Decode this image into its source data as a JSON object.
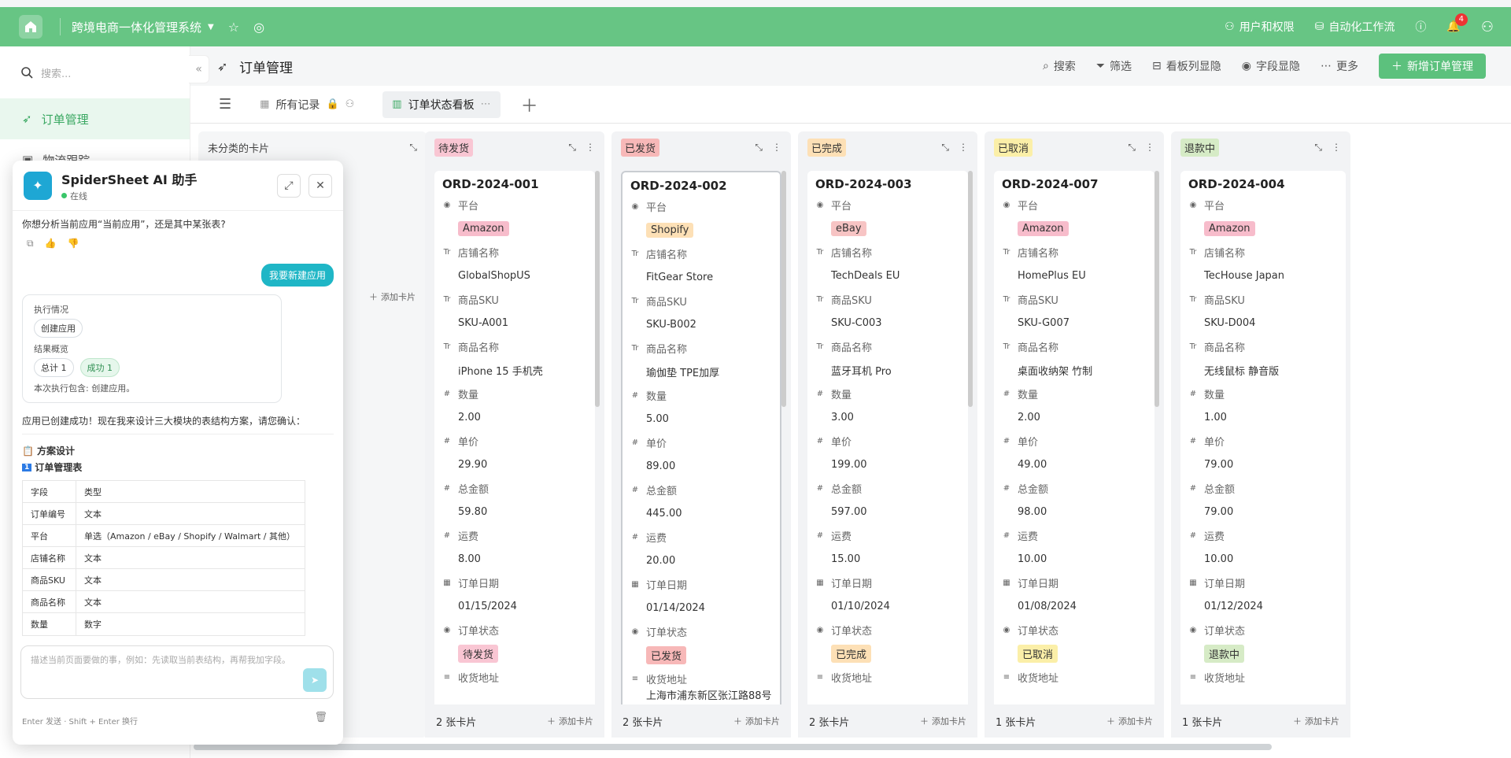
{
  "topbar": {
    "app_title": "跨境电商一体化管理系统",
    "users_label": "用户和权限",
    "workflow_label": "自动化工作流",
    "notification_count": "4"
  },
  "sidebar": {
    "search_placeholder": "搜索...",
    "items": [
      {
        "label": "订单管理"
      },
      {
        "label": "物流跟踪"
      }
    ]
  },
  "header": {
    "title": "订单管理",
    "actions": [
      "搜索",
      "筛选",
      "看板列显隐",
      "字段显隐",
      "更多"
    ],
    "primary": "新增订单管理"
  },
  "views": {
    "all": "所有记录",
    "kanban": "订单状态看板"
  },
  "board": {
    "uncategorized": {
      "title": "未分类的卡片",
      "add": "添加卡片"
    },
    "field_labels": [
      "平台",
      "店铺名称",
      "商品SKU",
      "商品名称",
      "数量",
      "单价",
      "总金额",
      "运费",
      "订单日期",
      "订单状态",
      "收货地址"
    ],
    "columns": [
      {
        "name": "待发货",
        "bg": "#f9c6d3",
        "color": "#333",
        "count": "2 张卡片",
        "add": "添加卡片",
        "card": {
          "id": "ORD-2024-001",
          "platform": "Amazon",
          "store": "GlobalShopUS",
          "sku": "SKU-A001",
          "product": "iPhone 15 手机壳",
          "qty": "2.00",
          "price": "29.90",
          "total": "59.80",
          "shipping": "8.00",
          "date": "01/15/2024",
          "status": "待发货",
          "address": ""
        }
      },
      {
        "name": "已发货",
        "bg": "#f7b8b8",
        "color": "#333",
        "count": "2 张卡片",
        "add": "添加卡片",
        "card": {
          "id": "ORD-2024-002",
          "platform": "Shopify",
          "store": "FitGear Store",
          "sku": "SKU-B002",
          "product": "瑜伽垫 TPE加厚",
          "qty": "5.00",
          "price": "89.00",
          "total": "445.00",
          "shipping": "20.00",
          "date": "01/14/2024",
          "status": "已发货",
          "address": "上海市浦东新区张江路88号"
        }
      },
      {
        "name": "已完成",
        "bg": "#fde0b6",
        "color": "#333",
        "count": "2 张卡片",
        "add": "添加卡片",
        "card": {
          "id": "ORD-2024-003",
          "platform": "eBay",
          "store": "TechDeals EU",
          "sku": "SKU-C003",
          "product": "蓝牙耳机 Pro",
          "qty": "3.00",
          "price": "199.00",
          "total": "597.00",
          "shipping": "15.00",
          "date": "01/10/2024",
          "status": "已完成",
          "address": ""
        }
      },
      {
        "name": "已取消",
        "bg": "#fbefa8",
        "color": "#333",
        "count": "1 张卡片",
        "add": "添加卡片",
        "card": {
          "id": "ORD-2024-007",
          "platform": "Amazon",
          "store": "HomePlus EU",
          "sku": "SKU-G007",
          "product": "桌面收纳架 竹制",
          "qty": "2.00",
          "price": "49.00",
          "total": "98.00",
          "shipping": "10.00",
          "date": "01/08/2024",
          "status": "已取消",
          "address": ""
        }
      },
      {
        "name": "退款中",
        "bg": "#d6ebc6",
        "color": "#333",
        "count": "1 张卡片",
        "add": "添加卡片",
        "card": {
          "id": "ORD-2024-004",
          "platform": "Amazon",
          "store": "TecHouse Japan",
          "sku": "SKU-D004",
          "product": "无线鼠标 静音版",
          "qty": "1.00",
          "price": "79.00",
          "total": "79.00",
          "shipping": "10.00",
          "date": "01/12/2024",
          "status": "退款中",
          "address": ""
        }
      }
    ],
    "platform_colors": {
      "Amazon": "#f7bccb",
      "Shopify": "#fde0b6",
      "eBay": "#f7c4c4"
    }
  },
  "ai": {
    "name": "SpiderSheet AI 助手",
    "status": "在线",
    "question": "你想分析当前应用“当前应用”，还是其中某张表?",
    "user_msg": "我要新建应用",
    "exec_title": "执行情况",
    "exec_chip": "创建应用",
    "result_title": "结果概览",
    "total_chip": "总计 1",
    "success_chip": "成功 1",
    "exec_summary": "本次执行包含: 创建应用。",
    "reply": "应用已创建成功！现在我来设计三大模块的表结构方案，请您确认：",
    "plan_title": "方案设计",
    "table_title": "订单管理表",
    "table_head": [
      "字段",
      "类型"
    ],
    "table_rows": [
      [
        "订单编号",
        "文本"
      ],
      [
        "平台",
        "单选（Amazon / eBay / Shopify / Walmart / 其他）"
      ],
      [
        "店铺名称",
        "文本"
      ],
      [
        "商品SKU",
        "文本"
      ],
      [
        "商品名称",
        "文本"
      ],
      [
        "数量",
        "数字"
      ]
    ],
    "input_placeholder": "描述当前页面要做的事，例如：先读取当前表结构，再帮我加字段。",
    "footer": "Enter 发送 · Shift + Enter 换行"
  }
}
